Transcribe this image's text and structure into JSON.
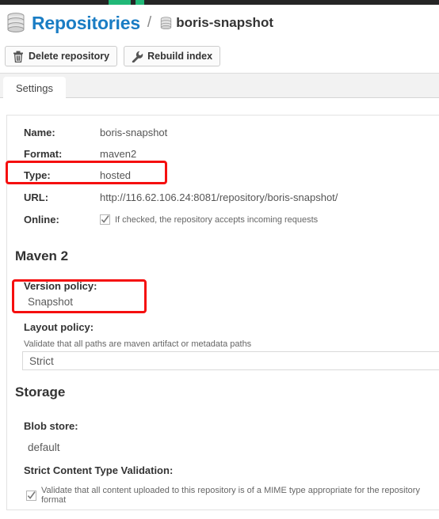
{
  "topbar": {
    "accent_color": "#21b877",
    "bar_color": "#252525"
  },
  "header": {
    "root_label": "Repositories",
    "separator": "/",
    "leaf_label": "boris-snapshot",
    "root_icon": "database-icon",
    "leaf_icon": "database-icon",
    "root_color": "#1a7dc4"
  },
  "toolbar": {
    "buttons": [
      {
        "label": "Delete repository",
        "icon": "trash-icon"
      },
      {
        "label": "Rebuild index",
        "icon": "wrench-icon"
      }
    ]
  },
  "tabs": [
    {
      "label": "Settings",
      "selected": true
    }
  ],
  "fields": [
    {
      "label": "Name:",
      "value": "boris-snapshot"
    },
    {
      "label": "Format:",
      "value": "maven2"
    },
    {
      "label": "Type:",
      "value": "hosted"
    },
    {
      "label": "URL:",
      "value": "http://116.62.106.24:8081/repository/boris-snapshot/"
    }
  ],
  "online": {
    "label": "Online:",
    "checkbox_text": "If checked, the repository accepts incoming requests",
    "checked": true
  },
  "maven_section": {
    "heading": "Maven 2",
    "version_policy": {
      "label": "Version policy:",
      "value": "Snapshot"
    },
    "layout_policy": {
      "label": "Layout policy:",
      "hint": "Validate that all paths are maven artifact or metadata paths",
      "value": "Strict"
    }
  },
  "storage_section": {
    "heading": "Storage",
    "blob_store": {
      "label": "Blob store:",
      "value": "default"
    },
    "strict_content": {
      "label": "Strict Content Type Validation:",
      "checkbox_text": "Validate that all content uploaded to this repository is of a MIME type appropriate for the repository format",
      "checked": true
    }
  },
  "annotations": {
    "color": "#f50f0f",
    "boxes": [
      {
        "target": "type-field"
      },
      {
        "target": "version-policy-field"
      }
    ]
  }
}
